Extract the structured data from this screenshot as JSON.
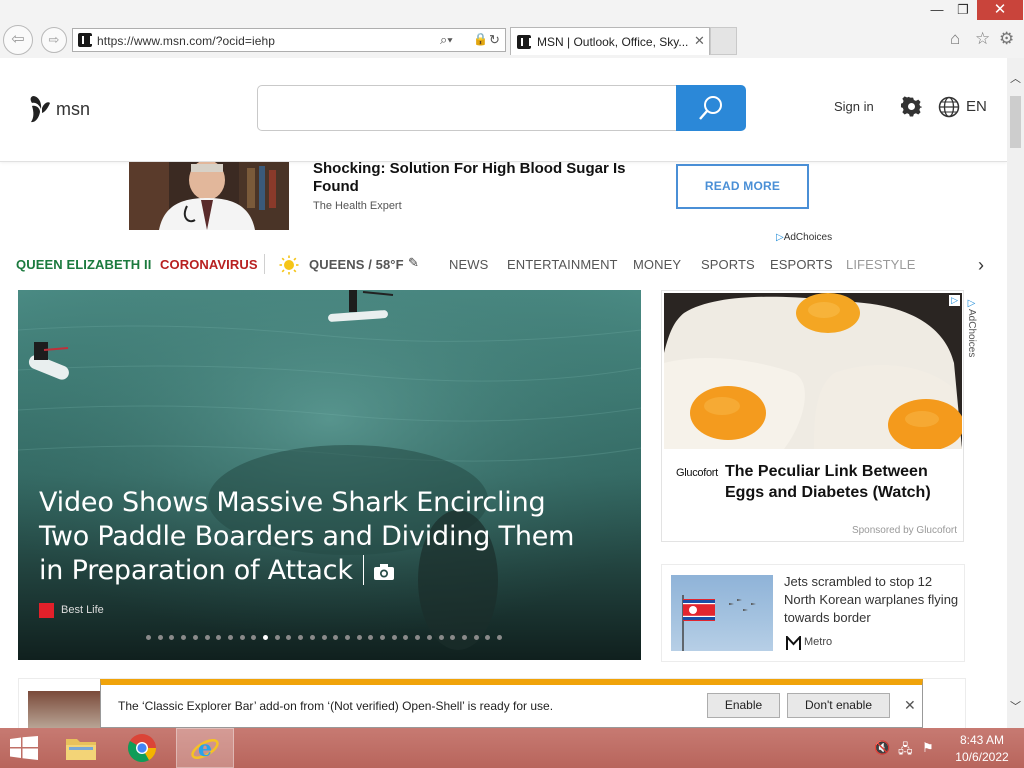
{
  "browser": {
    "url": "https://www.msn.com/?ocid=iehp",
    "tab_title": "MSN | Outlook, Office, Sky...",
    "tab_close": "✕",
    "window_close": "✕",
    "window_minimize": "—",
    "window_restore": "❐"
  },
  "header": {
    "logo_text": "msn",
    "search_value": "",
    "sign_in": "Sign in",
    "language": "EN"
  },
  "top_ad": {
    "title": "Shocking: Solution For High Blood Sugar Is Found",
    "source": "The Health Expert",
    "cta": "READ MORE",
    "adchoices": "AdChoices"
  },
  "nav": {
    "items": [
      {
        "label": "QUEEN ELIZABETH II",
        "color": "#1b7a3e"
      },
      {
        "label": "CORONAVIRUS",
        "color": "#b82020"
      },
      {
        "label": "QUEENS / 58°F",
        "color": "#555555"
      },
      {
        "label": "NEWS",
        "color": "#555555"
      },
      {
        "label": "ENTERTAINMENT",
        "color": "#555555"
      },
      {
        "label": "MONEY",
        "color": "#555555"
      },
      {
        "label": "SPORTS",
        "color": "#555555"
      },
      {
        "label": "ESPORTS",
        "color": "#555555"
      },
      {
        "label": "LIFESTYLE",
        "color": "#555555"
      }
    ]
  },
  "hero": {
    "title": "Video Shows Massive Shark Encircling Two Paddle Boarders and Dividing Them in Preparation of Attack",
    "source": "Best Life",
    "slide_count": 31,
    "active_slide": 10
  },
  "side_ad": {
    "brand": "Glucofort",
    "title": "The Peculiar Link Between Eggs and Diabetes (Watch)",
    "sponsor": "Sponsored by Glucofort",
    "adchoices": "AdChoices"
  },
  "news_card": {
    "title": "Jets scrambled to stop 12 North Korean warplanes flying towards border",
    "source": "Metro"
  },
  "notification": {
    "text": "The ‘Classic Explorer Bar’ add-on from ‘(Not verified) Open-Shell’ is ready for use.",
    "enable": "Enable",
    "dont_enable": "Don't enable",
    "close": "✕"
  },
  "taskbar": {
    "time": "8:43 AM",
    "date": "10/6/2022"
  }
}
